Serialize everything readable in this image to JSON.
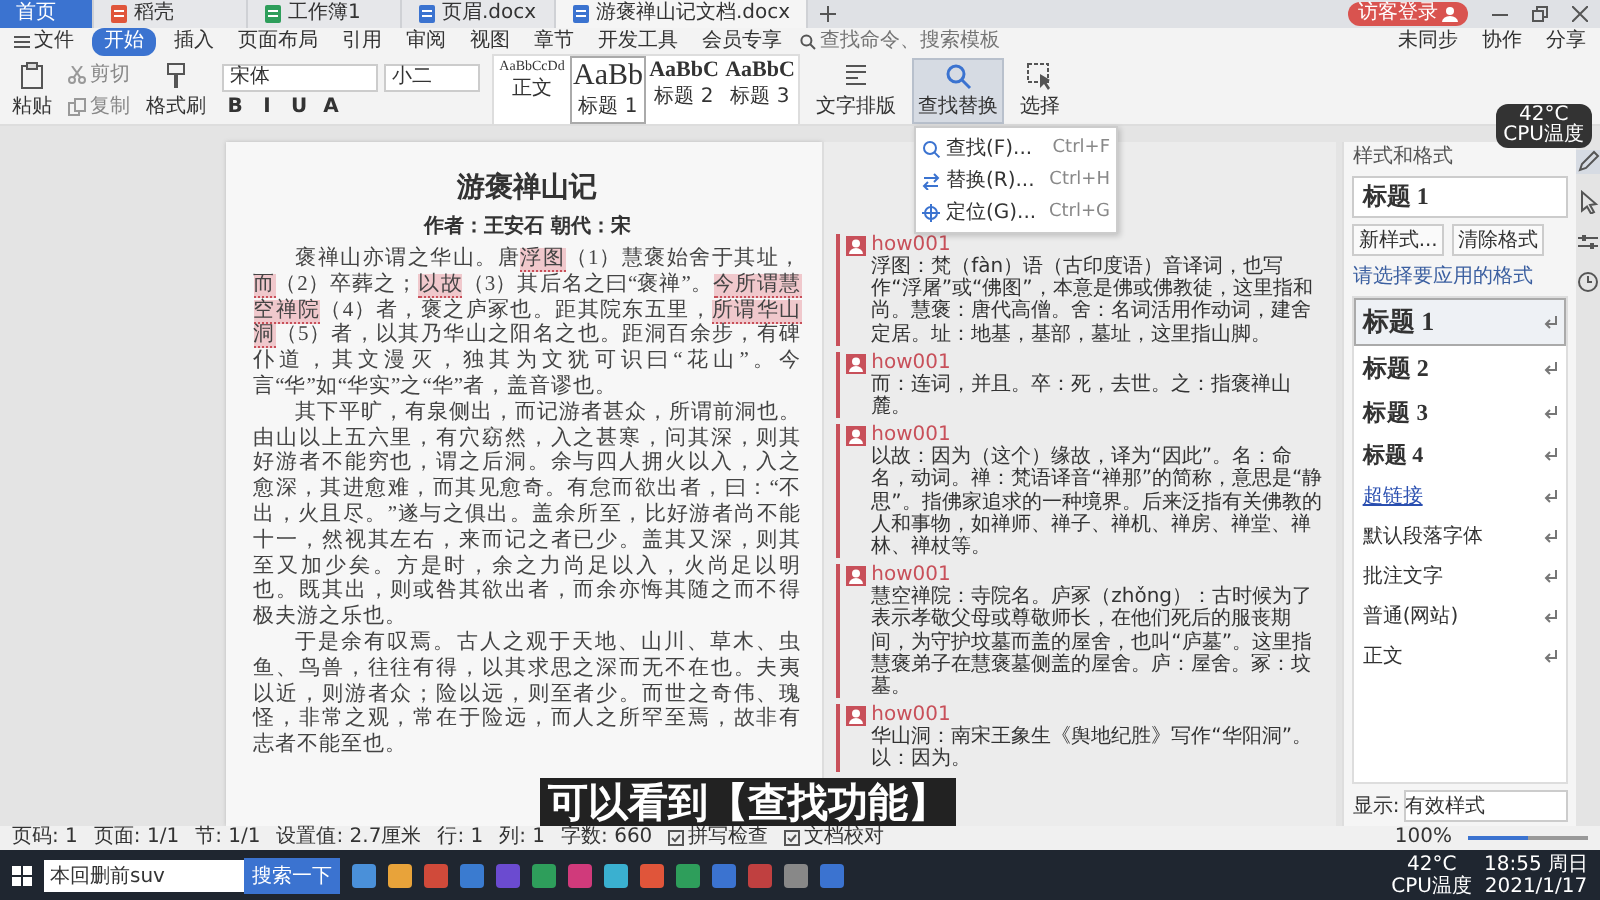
{
  "tabs": [
    {
      "label": "首页",
      "kind": "home",
      "selected": false
    },
    {
      "label": "稻壳",
      "kind": "daoke",
      "selected": false
    },
    {
      "label": "工作簿1",
      "kind": "sheet",
      "selected": false
    },
    {
      "label": "页眉.docx",
      "kind": "doc",
      "selected": false
    },
    {
      "label": "游褒禅山记文档.docx",
      "kind": "doc",
      "selected": true
    }
  ],
  "account": {
    "login": "访客登录"
  },
  "menu": {
    "file": "文件",
    "items": [
      {
        "label": "开始",
        "selected": true
      },
      {
        "label": "插入",
        "selected": false
      },
      {
        "label": "页面布局",
        "selected": false
      },
      {
        "label": "引用",
        "selected": false
      },
      {
        "label": "审阅",
        "selected": false
      },
      {
        "label": "视图",
        "selected": false
      },
      {
        "label": "章节",
        "selected": false
      },
      {
        "label": "开发工具",
        "selected": false
      },
      {
        "label": "会员专享",
        "selected": false
      }
    ],
    "search": {
      "placeholder": "查找命令、搜索模板"
    },
    "actions": [
      "未同步",
      "协作",
      "分享"
    ]
  },
  "ribbon": {
    "paste": "粘贴",
    "cut": "剪切",
    "copy": "复制",
    "format_painter": "格式刷",
    "font": "宋体",
    "size": "小二",
    "styles": [
      {
        "preview": "AaBbCcDd",
        "label": "正文",
        "kind": "small"
      },
      {
        "preview": "AaBb",
        "label": "标题 1",
        "kind": "large"
      },
      {
        "preview": "AaBbC",
        "label": "标题 2",
        "kind": "medium"
      },
      {
        "preview": "AaBbC",
        "label": "标题 3",
        "kind": "medium"
      }
    ],
    "format_buttons": [
      "B",
      "I",
      "U",
      "A"
    ],
    "layout": "文字排版",
    "find_replace": "查找替换",
    "select": "选择"
  },
  "find_menu": [
    {
      "label": "查找(F)...",
      "shortcut": "Ctrl+F",
      "kind": "find"
    },
    {
      "label": "替换(R)...",
      "shortcut": "Ctrl+H",
      "kind": "replace"
    },
    {
      "label": "定位(G)...",
      "shortcut": "Ctrl+G",
      "kind": "goto"
    }
  ],
  "document": {
    "title": "游褒禅山记",
    "author": "作者：王安石  朝代：宋",
    "paragraphs": [
      [
        {
          "text": "褒禅山亦谓之华山。唐",
          "highlight": false
        },
        {
          "text": "浮图",
          "highlight": true
        },
        {
          "text": "（1）慧褒始舍于其址，",
          "highlight": false
        },
        {
          "text": "而",
          "highlight": true
        },
        {
          "text": "（2）卒葬之；",
          "highlight": false
        },
        {
          "text": "以故",
          "highlight": true
        },
        {
          "text": "（3）其后名之曰“褒禅”。",
          "highlight": false
        },
        {
          "text": "今所谓慧空禅院",
          "highlight": true
        },
        {
          "text": "（4）者，褒之庐冢也。距其院东五里，",
          "highlight": false
        },
        {
          "text": "所谓华山洞",
          "highlight": true
        },
        {
          "text": "（5）者，以其乃华山之阳名之也。距洞百余步，有碑仆道，其文漫灭，独其为文犹可识曰“花山”。今言“华”如“华实”之“华”者，盖音谬也。",
          "highlight": false
        }
      ],
      [
        {
          "text": "其下平旷，有泉侧出，而记游者甚众，所谓前洞也。由山以上五六里，有穴窈然，入之甚寒，问其深，则其好游者不能穷也，谓之后洞。余与四人拥火以入，入之愈深，其进愈难，而其见愈奇。有怠而欲出者，曰：“不出，火且尽。”遂与之俱出。盖余所至，比好游者尚不能十一，然视其左右，来而记之者已少。盖其又深，则其至又加少矣。方是时，余之力尚足以入，火尚足以明也。既其出，则或咎其欲出者，而余亦悔其随之而不得极夫游之乐也。",
          "highlight": false
        }
      ],
      [
        {
          "text": "于是余有叹焉。古人之观于天地、山川、草木、虫鱼、鸟兽，往往有得，以其求思之深而无不在也。夫夷以近，则游者众；险以远，则至者少。而世之奇伟、瑰怪，非常之观，常在于险远，而人之所罕至焉，故非有志者不能至也。",
          "highlight": false
        }
      ]
    ]
  },
  "comments": [
    {
      "author": "how001",
      "text": "浮图：梵（fàn）语（古印度语）音译词，也写作“浮屠”或“佛图”，本意是佛或佛教徒，这里指和尚。慧褒：唐代高僧。舍：名词活用作动词，建舍定居。址：地基，基部，墓址，这里指山脚。"
    },
    {
      "author": "how001",
      "text": "而：连词，并且。卒：死，去世。之：指褒禅山麓。"
    },
    {
      "author": "how001",
      "text": "以故：因为（这个）缘故，译为“因此”。名：命名，动词。禅：梵语译音“禅那”的简称，意思是“静思”。指佛家追求的一种境界。后来泛指有关佛教的人和事物，如禅师、禅子、禅机、禅房、禅堂、禅林、禅杖等。"
    },
    {
      "author": "how001",
      "text": "慧空禅院：寺院名。庐冢（zhǒng）：古时候为了表示孝敬父母或尊敬师长，在他们死后的服丧期间，为守护坟墓而盖的屋舍，也叫“庐墓”。这里指慧褒弟子在慧褒墓侧盖的屋舍。庐：屋舍。冢：坟墓。"
    },
    {
      "author": "how001",
      "text": "华山洞：南宋王象生《舆地纪胜》写作“华阳洞”。以：因为。"
    }
  ],
  "styles_pane": {
    "title": "样式和格式",
    "current": "标题 1",
    "new_style": "新样式...",
    "clear": "清除格式",
    "prompt": "请选择要应用的格式",
    "items": [
      {
        "label": "标题 1",
        "kind": "h1",
        "selected": true
      },
      {
        "label": "标题 2",
        "kind": "h2",
        "selected": false
      },
      {
        "label": "标题 3",
        "kind": "h3",
        "selected": false
      },
      {
        "label": "标题 4",
        "kind": "h4",
        "selected": false
      },
      {
        "label": "超链接",
        "kind": "link",
        "selected": false
      },
      {
        "label": "默认段落字体",
        "kind": "small",
        "selected": false
      },
      {
        "label": "批注文字",
        "kind": "plain",
        "selected": false
      },
      {
        "label": "普通(网站)",
        "kind": "plain",
        "selected": false
      },
      {
        "label": "正文",
        "kind": "plain",
        "selected": false
      }
    ],
    "show_label": "显示:",
    "show_value": "有效样式"
  },
  "caption": "可以看到【查找功能】",
  "cpu_widget": {
    "temp": "42°C",
    "label": "CPU温度"
  },
  "status_bar": {
    "items": [
      "页码: 1",
      "页面: 1/1",
      "节: 1/1",
      "设置值: 2.7厘米",
      "行: 1",
      "列: 1",
      "字数: 660"
    ],
    "spell": "拼写检查",
    "proof": "文档校对",
    "zoom": "100%",
    "zoom_slider": {
      "level": 0.5
    }
  },
  "taskbar": {
    "search_value": "本回删前suv",
    "search_button": "搜索一下",
    "cpu_temp": "42°C",
    "cpu_label": "CPU温度",
    "time": "18:55 周日",
    "date": "2021/1/17"
  }
}
